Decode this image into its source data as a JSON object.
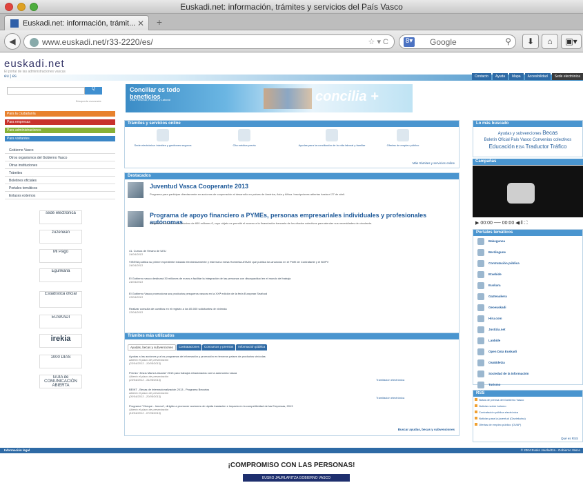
{
  "window": {
    "title": "Euskadi.net: información, trámites y servicios del País Vasco"
  },
  "tab": {
    "label": "Euskadi.net: información, trámit..."
  },
  "address": {
    "url": "www.euskadi.net/r33-2220/es/",
    "search_placeholder": "Google"
  },
  "logo": {
    "name": "euskadi.net",
    "tagline": "El portal de las administraciones vascas"
  },
  "topnav": [
    "Contacto",
    "Ayuda",
    "Mapa",
    "Accesibilidad",
    "Sede electrónica"
  ],
  "lang": "eu | es",
  "search": {
    "button": "Q",
    "advanced": "Búsqueda avanzada"
  },
  "categories": [
    {
      "label": "Para la ciudadanía",
      "color": "#e8822e"
    },
    {
      "label": "Para empresas",
      "color": "#c8312b"
    },
    {
      "label": "Para administraciones",
      "color": "#87b036"
    },
    {
      "label": "Para visitantes",
      "color": "#3a86c6"
    }
  ],
  "left_menu": [
    "Gobierno Vasco",
    "Otros organismos del Gobierno Vasco",
    "Otras instituciones",
    "Trámites",
    "Boletines oficiales",
    "Portales temáticos",
    "Enlaces externos"
  ],
  "banners": [
    "sede electrónica",
    "zuzenean",
    "Mi Pago",
    "Egunkaria",
    "Estadística oficial",
    "EUSKADI",
    "irekia",
    "1000 DÍAS",
    "GUÍA de COMUNICACIÓN ABIERTA"
  ],
  "promo": {
    "title1": "Conciliar es todo",
    "title2": "beneficios",
    "sub": "Vida Personal, Familiar y Laboral",
    "brand": "concilia +"
  },
  "tramites": {
    "title": "Trámites y servicios online",
    "items": [
      "Sede electrónica: trámites y gestiones seguros",
      "Cita médica previa",
      "Ayudas para la conciliación de la vida laboral y familiar",
      "Ofertas de empleo público"
    ],
    "more": "Más trámites y servicios online"
  },
  "destacados": {
    "title": "Destacados",
    "n1": {
      "title": "Juventud Vasca Cooperante 2013",
      "sub": "Programa para participar directamente en acciones de cooperación al desarrollo en países de América, Asia y África. Inscripciones abiertas hasta el 27 de abril."
    },
    "n2": {
      "title": "Programa de apoyo financiero a PYMEs, personas empresariales individuales y profesionales autónomas",
      "sub": "Programa dotado con un máximo de 600 millones €, cuyo objeto es permitir el acceso a la financiación bancaria de los citados colectivos para atender sus necesidades de circulante."
    },
    "list": [
      {
        "t": "41. Cursos de Verano de UEU",
        "d": "24/04/2013"
      },
      {
        "t": "VISESA publica su primer expediente iniciado electrónicamente y estrena la mesa Homerkia ATAZO que publica los anuncios en el Perfil de Contratante y el BOPV",
        "d": "24/04/2013"
      },
      {
        "t": "El Gobierno vasco destinará 30 millones de euros a facilitar la integración de las personas con discapacidad en el mundo del trabajo",
        "d": "24/04/2013"
      },
      {
        "t": "El Gobierno Vasco promociona sus productos pesqueros vascos en la XXIª edición de la feria European Seafood",
        "d": "23/04/2013"
      },
      {
        "t": "Realizar consulta de cambios en el registro a los 85.000 solicitantes de vivienda",
        "d": "23/04/2013"
      }
    ]
  },
  "mas_utilizados": {
    "title": "Trámites más utilizados",
    "tabs": [
      "Ayudas, becas y subvenciones",
      "Contrataciones",
      "Concursos y premios",
      "Información pública"
    ],
    "items": [
      {
        "t": "Ayudas a las acciones y a los programas de información y promoción en terceros países de productos vinícolas",
        "s": "Abierto el plazo de presentación",
        "d": "(23/04/2013 - 10/05/2013)"
      },
      {
        "t": "Premio \"Jesús María Leizaola\" 2013 para trabajos relacionados con la autonomía vasca",
        "s": "Abierto el plazo de presentación",
        "d": "(23/04/2013 - 31/05/2013)"
      },
      {
        "t": "BEINT - Becas de Internacionalización 2013 - Programa Becarios",
        "s": "Abierto el plazo de presentación",
        "d": "(20/04/2013 - 20/05/2013)"
      },
      {
        "t": "Programa \"Cheque - Innova\", dirigido a promover acciones de rápida traslación e impacto en la competitividad de las Empresas, 2013",
        "s": "Abierto el plazo de presentación",
        "d": "(19/04/2013 - 07/06/2013)"
      }
    ],
    "e_label": "Tramitación electrónica",
    "more": "Buscar ayudas, becas y subvenciones"
  },
  "lo_mas_buscado": {
    "title": "Lo más buscado",
    "tags": [
      "Ayudas y subvenciones",
      "Becas",
      "Boletín Oficial País Vasco",
      "Convenios colectivos",
      "Educación",
      "EGA",
      "Traductor",
      "Tráfico"
    ]
  },
  "campanas": {
    "title": "Campañas",
    "time1": "00:00",
    "time2": "00:00"
  },
  "portales": {
    "title": "Portales temáticos",
    "items": [
      "Bakeguneа",
      "Berdingune",
      "Contratación pública",
      "Etxebide",
      "Euskara",
      "Gazteaukera",
      "Geoeuskadi",
      "Hiru.com",
      "Justizia.net",
      "Lanbide",
      "Open Data Euskadi",
      "Osakidetza",
      "Sociedad de la información",
      "Turismo"
    ]
  },
  "rss": {
    "title": "RSS",
    "items": [
      "Notas de prensa del Gobierno Vasco",
      "Noticias sobre turismo",
      "Contratación pública electrónica",
      "Noticias para la juventud (Gaztekutxa)",
      "Ofertas de empleo público (OVAP)"
    ],
    "more": "Qué es RSS"
  },
  "footer": {
    "left": "Información legal",
    "right": "© 2004 Eusko Jaurlaritza - Gobierno Vasco",
    "slogan": "¡COMPROMISO CON LAS PERSONAS!",
    "gov": "EUSKO JAURLARITZA  GOBIERNO VASCO"
  }
}
